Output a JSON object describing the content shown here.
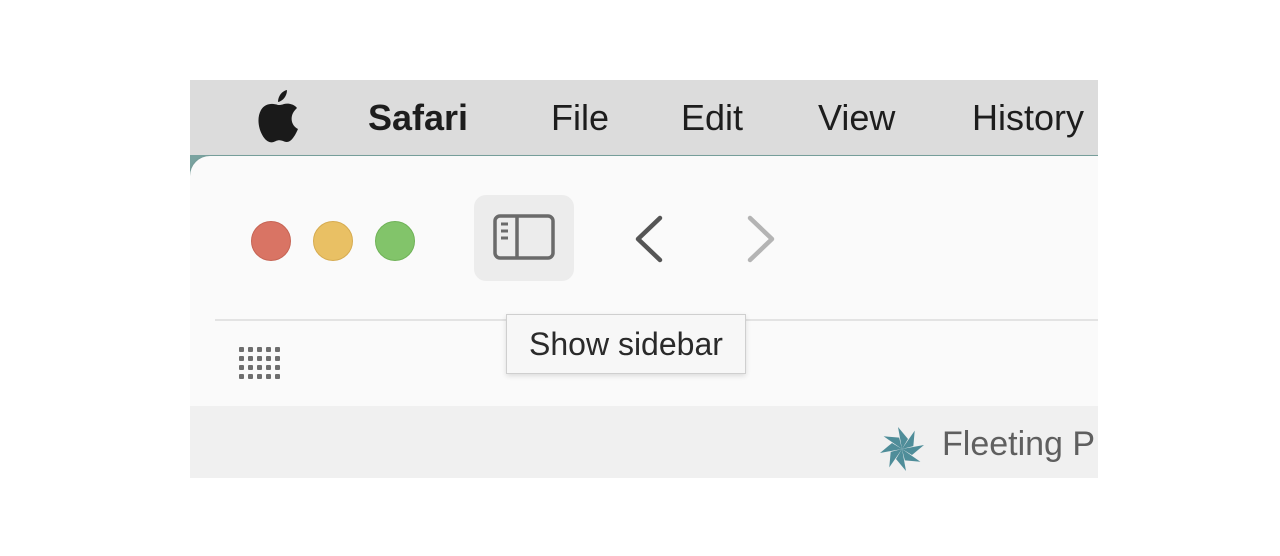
{
  "menubar": {
    "apple_icon": "apple-icon",
    "app_name": "Safari",
    "items": [
      "File",
      "Edit",
      "View",
      "History"
    ]
  },
  "window": {
    "traffic_lights": {
      "close": "#d97464",
      "minimize": "#e9c064",
      "maximize": "#82c46a"
    },
    "toolbar": {
      "sidebar_icon": "sidebar-icon",
      "back_icon": "chevron-left-icon",
      "forward_icon": "chevron-right-icon"
    },
    "tooltip": "Show sidebar",
    "tab_overview_icon": "grid-icon"
  },
  "tab": {
    "favicon": "pinwheel-icon",
    "title": "Fleeting P",
    "favicon_color": "#4f8d99"
  }
}
